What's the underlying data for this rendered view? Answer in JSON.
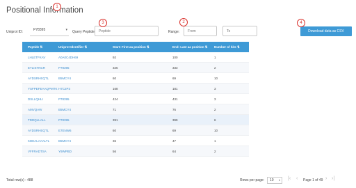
{
  "page": {
    "title": "Positional Information"
  },
  "filters": {
    "uniprot_label": "Uniprot ID:",
    "uniprot_value": "P78395",
    "peptide_label": "Query Peptide:",
    "peptide_placeholder": "Peptide",
    "range_label": "Range:",
    "from_placeholder": "From",
    "to_placeholder": "To"
  },
  "badges": [
    "1",
    "2",
    "3",
    "4"
  ],
  "download_button": "Download data as CSV",
  "table": {
    "headers": [
      "Peptide ⇅",
      "Uniprot Identifier ⇅",
      "Start: First aa position ⇅",
      "End: Last aa position ⇅",
      "Number of hits ⇅"
    ],
    "rows": [
      {
        "peptide": "LHLETFKAV",
        "uniprot": "A0A0C4DH69",
        "start": "92",
        "end": "100",
        "hits": "1"
      },
      {
        "peptide": "ETLISTNCR",
        "uniprot": "P78395",
        "start": "325",
        "end": "333",
        "hits": "2"
      },
      {
        "peptide": "AYDSRHEQTL",
        "uniprot": "B5MCY4",
        "start": "60",
        "end": "69",
        "hits": "10"
      },
      {
        "peptide": "YSFPEFEAAQPMTK",
        "uniprot": "H7C2P3",
        "start": "168",
        "end": "181",
        "hits": "3"
      },
      {
        "peptide": "DSLLQHLI",
        "uniprot": "P78395",
        "start": "424",
        "end": "431",
        "hits": "3"
      },
      {
        "peptide": "AMVQAW",
        "uniprot": "B5MCY4",
        "start": "71",
        "end": "76",
        "hits": "2"
      },
      {
        "peptide": "TDDQLLALL",
        "uniprot": "P78395",
        "start": "391",
        "end": "399",
        "hits": "6"
      },
      {
        "peptide": "AYDSRHEQTL",
        "uniprot": "E7ENW6",
        "start": "60",
        "end": "69",
        "hits": "10"
      },
      {
        "peptide": "KDEALAAALTL",
        "uniprot": "B5MCY4",
        "start": "36",
        "end": "47",
        "hits": "1"
      },
      {
        "peptide": "VFFRADTSA",
        "uniprot": "Y9WPBD",
        "start": "56",
        "end": "64",
        "hits": "2"
      }
    ]
  },
  "footer": {
    "total": "Total row(s) : 488",
    "rows_per_page_label": "Rows per page:",
    "rows_per_page_value": "10",
    "page_info": "Page 1 of 49"
  }
}
